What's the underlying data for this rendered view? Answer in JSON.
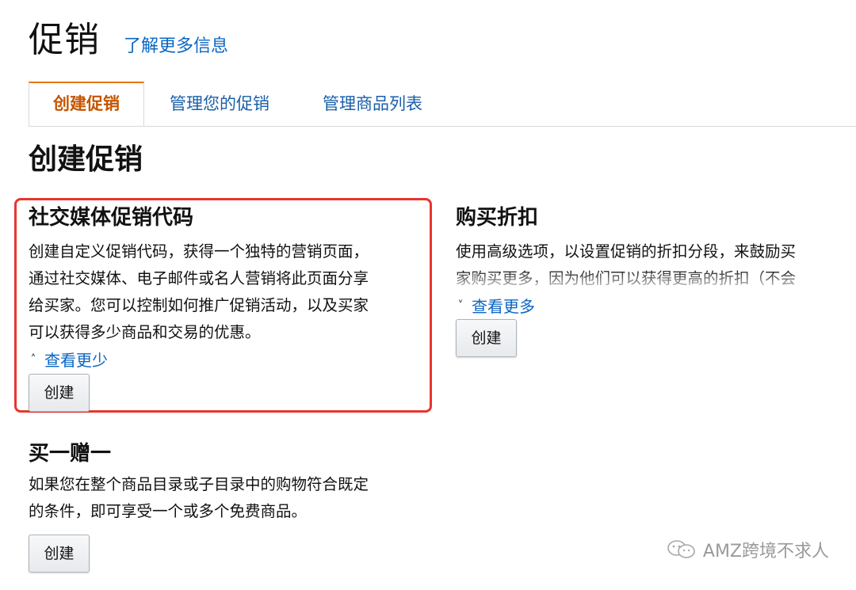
{
  "header": {
    "title": "促销",
    "learn_more": "了解更多信息"
  },
  "tabs": [
    {
      "label": "创建促销",
      "active": true
    },
    {
      "label": "管理您的促销",
      "active": false
    },
    {
      "label": "管理商品列表",
      "active": false
    }
  ],
  "section_heading": "创建促销",
  "promotions": {
    "social": {
      "title": "社交媒体促销代码",
      "lines": [
        "创建自定义促销代码，获得一个独特的营销页面，",
        "通过社交媒体、电子邮件或名人营销将此页面分享",
        "给买家。您可以控制如何推广促销活动，以及买家",
        "可以获得多少商品和交易的优惠。"
      ],
      "toggle_label": "查看更少",
      "button_label": "创建"
    },
    "purchase_discount": {
      "title": "购买折扣",
      "lines": [
        "使用高级选项，以设置促销的折扣分段，来鼓励买",
        "家购买更多，因为他们可以获得更高的折扣（不会"
      ],
      "toggle_label": "查看更多",
      "button_label": "创建"
    },
    "bogo": {
      "title": "买一赠一",
      "lines": [
        "如果您在整个商品目录或子目录中的购物符合既定",
        "的条件，即可享受一个或多个免费商品。"
      ],
      "button_label": "创建"
    }
  },
  "watermark": {
    "text": "AMZ跨境不求人",
    "icon": "wechat-icon"
  },
  "colors": {
    "link": "#0a66c2",
    "active_tab_text": "#c45500",
    "active_tab_border": "#e77600",
    "highlight_border": "#e8352f"
  }
}
